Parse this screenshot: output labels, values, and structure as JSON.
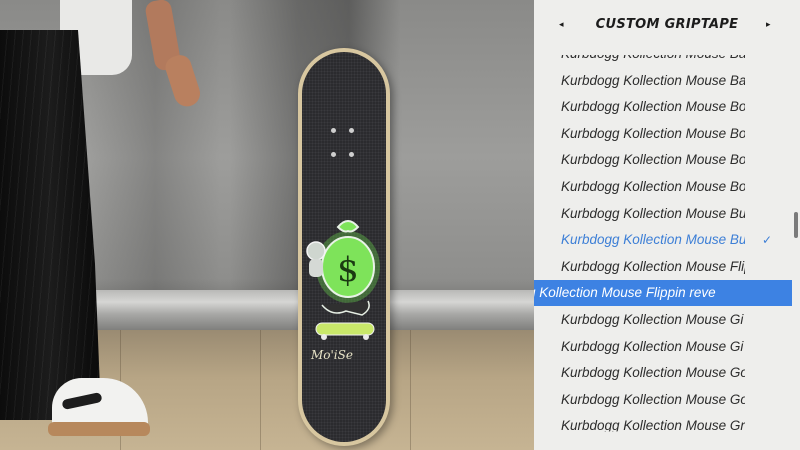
{
  "panel": {
    "title": "CUSTOM GRIPTAPE",
    "prev_icon": "triangle-left-icon",
    "next_icon": "triangle-right-icon",
    "check_glyph": "✓",
    "accent_color": "#3d82e3",
    "items": [
      {
        "label": "Kurbdogg Kollection Mouse Ba",
        "state": "partial"
      },
      {
        "label": "Kurbdogg Kollection Mouse Ba",
        "state": "normal"
      },
      {
        "label": "Kurbdogg Kollection Mouse Bo",
        "state": "normal"
      },
      {
        "label": "Kurbdogg Kollection Mouse Bo",
        "state": "normal"
      },
      {
        "label": "Kurbdogg Kollection Mouse Bo",
        "state": "normal"
      },
      {
        "label": "Kurbdogg Kollection Mouse Bo",
        "state": "normal"
      },
      {
        "label": "Kurbdogg Kollection Mouse Bu",
        "state": "normal"
      },
      {
        "label": "Kurbdogg Kollection Mouse Bu",
        "state": "equipped"
      },
      {
        "label": "Kurbdogg Kollection Mouse Flip",
        "state": "normal"
      },
      {
        "label": "g Kollection Mouse Flippin reve",
        "state": "highlighted"
      },
      {
        "label": "Kurbdogg Kollection Mouse Gi",
        "state": "normal"
      },
      {
        "label": "Kurbdogg Kollection Mouse Gi",
        "state": "normal"
      },
      {
        "label": "Kurbdogg Kollection Mouse Go",
        "state": "normal"
      },
      {
        "label": "Kurbdogg Kollection Mouse Go",
        "state": "normal"
      },
      {
        "label": "Kurbdogg Kollection Mouse Gr",
        "state": "partial"
      }
    ]
  },
  "deck_graphic": {
    "symbol": "$",
    "signature": "Mo'iSe"
  }
}
